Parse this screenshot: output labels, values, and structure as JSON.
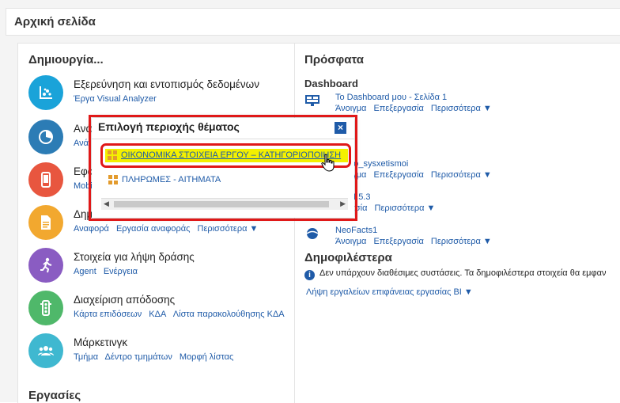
{
  "header": {
    "title": "Αρχική σελίδα"
  },
  "create": {
    "title": "Δημιουργία...",
    "items": [
      {
        "title": "Εξερεύνηση και εντοπισμός δεδομένων",
        "links": [
          "Έργα Visual Analyzer"
        ],
        "icon": "scatter-chart-icon",
        "color": "#1aa3d9"
      },
      {
        "title": "Ανά",
        "links": [
          "Ανά"
        ],
        "icon": "pie-chart-icon",
        "color": "#2c7cb5"
      },
      {
        "title": "Εφα",
        "links": [
          "Mobi"
        ],
        "icon": "mobile-icon",
        "color": "#e8563f"
      },
      {
        "title": "Δημ",
        "links": [
          "Αναφορά",
          "Εργασία αναφοράς",
          "Περισσότερα ▼"
        ],
        "icon": "report-icon",
        "color": "#f2a82f"
      },
      {
        "title": "Στοιχεία για λήψη δράσης",
        "links": [
          "Agent",
          "Ενέργεια"
        ],
        "icon": "runner-icon",
        "color": "#8a5cc2"
      },
      {
        "title": "Διαχείριση απόδοσης",
        "links": [
          "Κάρτα επιδόσεων",
          "ΚΔΑ",
          "Λίστα παρακολούθησης ΚΔΑ"
        ],
        "icon": "traffic-light-icon",
        "color": "#4fb86a"
      },
      {
        "title": "Μάρκετινγκ",
        "links": [
          "Τμήμα",
          "Δέντρο τμημάτων",
          "Μορφή λίστας"
        ],
        "icon": "group-icon",
        "color": "#3fb8d0"
      }
    ]
  },
  "tasks": {
    "title": "Εργασίες"
  },
  "recent": {
    "title": "Πρόσφατα",
    "dashboard_label": "Dashboard",
    "items": [
      {
        "name": "Το Dashboard μου - Σελίδα 1",
        "links": [
          "Άνοιγμα",
          "Επεξεργασία",
          "Περισσότερα ▼"
        ]
      },
      {
        "name": "hniaio_sysxetismoi",
        "links": [
          "Άνοιγμα",
          "Επεξεργασία",
          "Περισσότερα ▼"
        ]
      },
      {
        "name": ".II.5.3",
        "links": [
          "γασία",
          "Περισσότερα ▼"
        ]
      },
      {
        "name": "NeoFacts1",
        "links": [
          "Άνοιγμα",
          "Επεξεργασία",
          "Περισσότερα ▼"
        ]
      }
    ]
  },
  "popular": {
    "title": "Δημοφιλέστερα",
    "info_text": "Δεν υπάρχουν διαθέσιμες συστάσεις. Τα δημοφιλέστερα στοιχεία θα εμφαν",
    "bi_link": "Λήψη εργαλείων επιφάνειας εργασίας BI ▼"
  },
  "dialog": {
    "title": "Επιλογή περιοχής θέματος",
    "close_label": "×",
    "options": [
      {
        "label": "ΟΙΚΟΝΟΜΙΚΑ ΣΤΟΙΧΕΙΑ ΕΡΓΟΥ – ΚΑΤΗΓΟΡΙΟΠΟΙΗΣΗ",
        "highlighted": true
      },
      {
        "label": "ΠΛΗΡΩΜΕΣ - ΑΙΤΗΜΑΤΑ",
        "highlighted": false
      }
    ],
    "scroll_left": "◀",
    "scroll_right": "▶"
  },
  "colors": {
    "link": "#1f5ba8",
    "highlight": "#f4f000",
    "annotation": "#e01818"
  }
}
